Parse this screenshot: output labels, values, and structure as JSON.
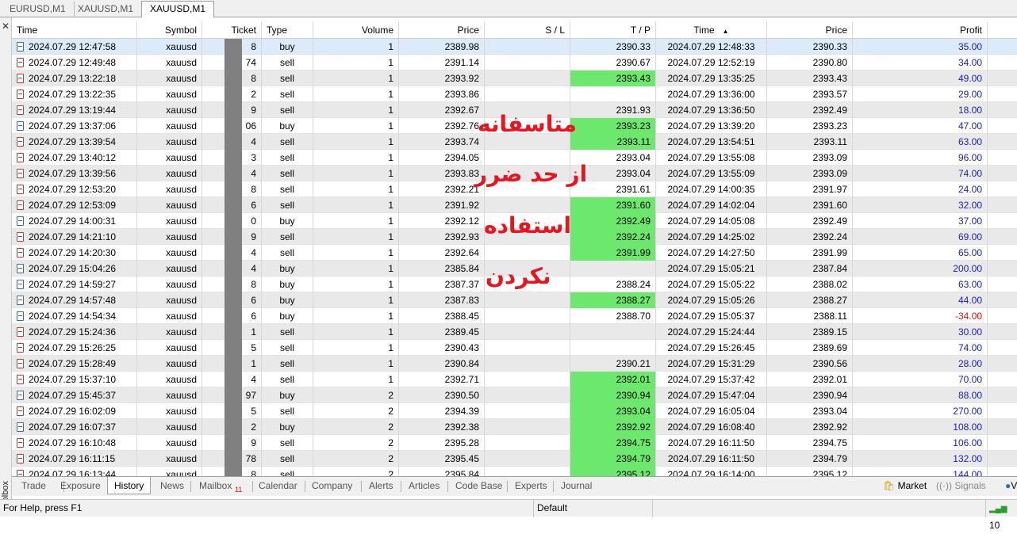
{
  "chart_tabs": [
    "EURUSD,M1",
    "XAUUSD,M1",
    "XAUUSD,M1"
  ],
  "columns": [
    "Time",
    "Symbol",
    "Ticket",
    "Type",
    "Volume",
    "Price",
    "S / L",
    "T / P",
    "Time",
    "Price",
    "Profit"
  ],
  "sort_indicator": "▲",
  "rows": [
    {
      "open_time": "2024.07.29 12:47:58",
      "symbol": "xauusd",
      "ticket": "8",
      "type": "buy",
      "volume": "1",
      "price": "2389.98",
      "sl": "",
      "tp": "2390.33",
      "tp_hit": false,
      "close_time": "2024.07.29 12:48:33",
      "close_price": "2390.33",
      "profit": "35.00"
    },
    {
      "open_time": "2024.07.29 12:49:48",
      "symbol": "xauusd",
      "ticket": "74",
      "type": "sell",
      "volume": "1",
      "price": "2391.14",
      "sl": "",
      "tp": "2390.67",
      "tp_hit": false,
      "close_time": "2024.07.29 12:52:19",
      "close_price": "2390.80",
      "profit": "34.00"
    },
    {
      "open_time": "2024.07.29 13:22:18",
      "symbol": "xauusd",
      "ticket": "8",
      "type": "sell",
      "volume": "1",
      "price": "2393.92",
      "sl": "",
      "tp": "2393.43",
      "tp_hit": true,
      "close_time": "2024.07.29 13:35:25",
      "close_price": "2393.43",
      "profit": "49.00"
    },
    {
      "open_time": "2024.07.29 13:22:35",
      "symbol": "xauusd",
      "ticket": "2",
      "type": "sell",
      "volume": "1",
      "price": "2393.86",
      "sl": "",
      "tp": "",
      "tp_hit": false,
      "close_time": "2024.07.29 13:36:00",
      "close_price": "2393.57",
      "profit": "29.00"
    },
    {
      "open_time": "2024.07.29 13:19:44",
      "symbol": "xauusd",
      "ticket": "9",
      "type": "sell",
      "volume": "1",
      "price": "2392.67",
      "sl": "",
      "tp": "2391.93",
      "tp_hit": false,
      "close_time": "2024.07.29 13:36:50",
      "close_price": "2392.49",
      "profit": "18.00"
    },
    {
      "open_time": "2024.07.29 13:37:06",
      "symbol": "xauusd",
      "ticket": "06",
      "type": "buy",
      "volume": "1",
      "price": "2392.76",
      "sl": "",
      "tp": "2393.23",
      "tp_hit": true,
      "close_time": "2024.07.29 13:39:20",
      "close_price": "2393.23",
      "profit": "47.00"
    },
    {
      "open_time": "2024.07.29 13:39:54",
      "symbol": "xauusd",
      "ticket": "4",
      "type": "sell",
      "volume": "1",
      "price": "2393.74",
      "sl": "",
      "tp": "2393.11",
      "tp_hit": true,
      "close_time": "2024.07.29 13:54:51",
      "close_price": "2393.11",
      "profit": "63.00"
    },
    {
      "open_time": "2024.07.29 13:40:12",
      "symbol": "xauusd",
      "ticket": "3",
      "type": "sell",
      "volume": "1",
      "price": "2394.05",
      "sl": "",
      "tp": "2393.04",
      "tp_hit": false,
      "close_time": "2024.07.29 13:55:08",
      "close_price": "2393.09",
      "profit": "96.00"
    },
    {
      "open_time": "2024.07.29 13:39:56",
      "symbol": "xauusd",
      "ticket": "4",
      "type": "sell",
      "volume": "1",
      "price": "2393.83",
      "sl": "",
      "tp": "2393.04",
      "tp_hit": false,
      "close_time": "2024.07.29 13:55:09",
      "close_price": "2393.09",
      "profit": "74.00"
    },
    {
      "open_time": "2024.07.29 12:53:20",
      "symbol": "xauusd",
      "ticket": "8",
      "type": "sell",
      "volume": "1",
      "price": "2392.21",
      "sl": "",
      "tp": "2391.61",
      "tp_hit": false,
      "close_time": "2024.07.29 14:00:35",
      "close_price": "2391.97",
      "profit": "24.00"
    },
    {
      "open_time": "2024.07.29 12:53:09",
      "symbol": "xauusd",
      "ticket": "6",
      "type": "sell",
      "volume": "1",
      "price": "2391.92",
      "sl": "",
      "tp": "2391.60",
      "tp_hit": true,
      "close_time": "2024.07.29 14:02:04",
      "close_price": "2391.60",
      "profit": "32.00"
    },
    {
      "open_time": "2024.07.29 14:00:31",
      "symbol": "xauusd",
      "ticket": "0",
      "type": "buy",
      "volume": "1",
      "price": "2392.12",
      "sl": "",
      "tp": "2392.49",
      "tp_hit": true,
      "close_time": "2024.07.29 14:05:08",
      "close_price": "2392.49",
      "profit": "37.00"
    },
    {
      "open_time": "2024.07.29 14:21:10",
      "symbol": "xauusd",
      "ticket": "9",
      "type": "sell",
      "volume": "1",
      "price": "2392.93",
      "sl": "",
      "tp": "2392.24",
      "tp_hit": true,
      "close_time": "2024.07.29 14:25:02",
      "close_price": "2392.24",
      "profit": "69.00"
    },
    {
      "open_time": "2024.07.29 14:20:30",
      "symbol": "xauusd",
      "ticket": "4",
      "type": "sell",
      "volume": "1",
      "price": "2392.64",
      "sl": "",
      "tp": "2391.99",
      "tp_hit": true,
      "close_time": "2024.07.29 14:27:50",
      "close_price": "2391.99",
      "profit": "65.00"
    },
    {
      "open_time": "2024.07.29 15:04:26",
      "symbol": "xauusd",
      "ticket": "4",
      "type": "buy",
      "volume": "1",
      "price": "2385.84",
      "sl": "",
      "tp": "",
      "tp_hit": false,
      "close_time": "2024.07.29 15:05:21",
      "close_price": "2387.84",
      "profit": "200.00"
    },
    {
      "open_time": "2024.07.29 14:59:27",
      "symbol": "xauusd",
      "ticket": "8",
      "type": "buy",
      "volume": "1",
      "price": "2387.37",
      "sl": "",
      "tp": "2388.24",
      "tp_hit": false,
      "close_time": "2024.07.29 15:05:22",
      "close_price": "2388.02",
      "profit": "63.00"
    },
    {
      "open_time": "2024.07.29 14:57:48",
      "symbol": "xauusd",
      "ticket": "6",
      "type": "buy",
      "volume": "1",
      "price": "2387.83",
      "sl": "",
      "tp": "2388.27",
      "tp_hit": true,
      "close_time": "2024.07.29 15:05:26",
      "close_price": "2388.27",
      "profit": "44.00"
    },
    {
      "open_time": "2024.07.29 14:54:34",
      "symbol": "xauusd",
      "ticket": "6",
      "type": "buy",
      "volume": "1",
      "price": "2388.45",
      "sl": "",
      "tp": "2388.70",
      "tp_hit": false,
      "close_time": "2024.07.29 15:05:37",
      "close_price": "2388.11",
      "profit": "-34.00"
    },
    {
      "open_time": "2024.07.29 15:24:36",
      "symbol": "xauusd",
      "ticket": "1",
      "type": "sell",
      "volume": "1",
      "price": "2389.45",
      "sl": "",
      "tp": "",
      "tp_hit": false,
      "close_time": "2024.07.29 15:24:44",
      "close_price": "2389.15",
      "profit": "30.00"
    },
    {
      "open_time": "2024.07.29 15:26:25",
      "symbol": "xauusd",
      "ticket": "5",
      "type": "sell",
      "volume": "1",
      "price": "2390.43",
      "sl": "",
      "tp": "",
      "tp_hit": false,
      "close_time": "2024.07.29 15:26:45",
      "close_price": "2389.69",
      "profit": "74.00"
    },
    {
      "open_time": "2024.07.29 15:28:49",
      "symbol": "xauusd",
      "ticket": "1",
      "type": "sell",
      "volume": "1",
      "price": "2390.84",
      "sl": "",
      "tp": "2390.21",
      "tp_hit": false,
      "close_time": "2024.07.29 15:31:29",
      "close_price": "2390.56",
      "profit": "28.00"
    },
    {
      "open_time": "2024.07.29 15:37:10",
      "symbol": "xauusd",
      "ticket": "4",
      "type": "sell",
      "volume": "1",
      "price": "2392.71",
      "sl": "",
      "tp": "2392.01",
      "tp_hit": true,
      "close_time": "2024.07.29 15:37:42",
      "close_price": "2392.01",
      "profit": "70.00"
    },
    {
      "open_time": "2024.07.29 15:45:37",
      "symbol": "xauusd",
      "ticket": "97",
      "type": "buy",
      "volume": "2",
      "price": "2390.50",
      "sl": "",
      "tp": "2390.94",
      "tp_hit": true,
      "close_time": "2024.07.29 15:47:04",
      "close_price": "2390.94",
      "profit": "88.00"
    },
    {
      "open_time": "2024.07.29 16:02:09",
      "symbol": "xauusd",
      "ticket": "5",
      "type": "sell",
      "volume": "2",
      "price": "2394.39",
      "sl": "",
      "tp": "2393.04",
      "tp_hit": true,
      "close_time": "2024.07.29 16:05:04",
      "close_price": "2393.04",
      "profit": "270.00"
    },
    {
      "open_time": "2024.07.29 16:07:37",
      "symbol": "xauusd",
      "ticket": "2",
      "type": "buy",
      "volume": "2",
      "price": "2392.38",
      "sl": "",
      "tp": "2392.92",
      "tp_hit": true,
      "close_time": "2024.07.29 16:08:40",
      "close_price": "2392.92",
      "profit": "108.00"
    },
    {
      "open_time": "2024.07.29 16:10:48",
      "symbol": "xauusd",
      "ticket": "9",
      "type": "sell",
      "volume": "2",
      "price": "2395.28",
      "sl": "",
      "tp": "2394.75",
      "tp_hit": true,
      "close_time": "2024.07.29 16:11:50",
      "close_price": "2394.75",
      "profit": "106.00"
    },
    {
      "open_time": "2024.07.29 16:11:15",
      "symbol": "xauusd",
      "ticket": "78",
      "type": "sell",
      "volume": "2",
      "price": "2395.45",
      "sl": "",
      "tp": "2394.79",
      "tp_hit": true,
      "close_time": "2024.07.29 16:11:50",
      "close_price": "2394.79",
      "profit": "132.00"
    },
    {
      "open_time": "2024.07.29 16:13:44",
      "symbol": "xauusd",
      "ticket": "8",
      "type": "sell",
      "volume": "2",
      "price": "2395.84",
      "sl": "",
      "tp": "2395.12",
      "tp_hit": true,
      "close_time": "2024.07.29 16:14:00",
      "close_price": "2395.12",
      "profit": "144.00"
    }
  ],
  "overlay_text": [
    "متاسفانه",
    "از حد ضرر",
    "استفاده",
    "نکردن"
  ],
  "bottom_tabs": [
    "Trade",
    "Exposure",
    "History",
    "News",
    "Mailbox",
    "Calendar",
    "Company",
    "Alerts",
    "Articles",
    "Code Base",
    "Experts",
    "Journal"
  ],
  "mailbox_badge": "11",
  "right_tools": {
    "market": "Market",
    "signals": "Signals",
    "vps": "VP"
  },
  "toolbox_label": "Toolbox",
  "status": {
    "help": "For Help, press F1",
    "profile": "Default",
    "connection": "10"
  },
  "colors": {
    "tp_hit": "#6ce96c",
    "profit": "#1a1acc",
    "loss": "#e01010",
    "overlay": "#e8141e"
  }
}
